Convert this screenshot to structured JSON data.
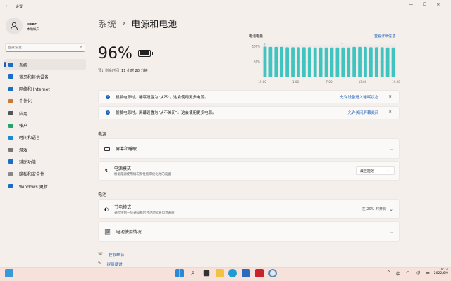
{
  "window": {
    "title": "设置",
    "back": "←"
  },
  "window_controls": {
    "minimize": "—",
    "maximize": "☐",
    "close": "✕"
  },
  "user": {
    "name": "user",
    "type": "本地帐户"
  },
  "search": {
    "placeholder": "查找设置"
  },
  "sidebar": {
    "items": [
      {
        "label": "系统",
        "color": "#1a6fc4"
      },
      {
        "label": "蓝牙和其他设备",
        "color": "#1a6fc4"
      },
      {
        "label": "网络和 Internet",
        "color": "#1a6fc4"
      },
      {
        "label": "个性化",
        "color": "#c77b3a"
      },
      {
        "label": "应用",
        "color": "#555"
      },
      {
        "label": "帐户",
        "color": "#2aa36b"
      },
      {
        "label": "时间和语言",
        "color": "#1a8ad4"
      },
      {
        "label": "游戏",
        "color": "#777"
      },
      {
        "label": "辅助功能",
        "color": "#1a6fc4"
      },
      {
        "label": "隐私和安全性",
        "color": "#888"
      },
      {
        "label": "Windows 更新",
        "color": "#1a6fc4"
      }
    ]
  },
  "breadcrumb": {
    "parent": "系统",
    "sep": "›",
    "current": "电源和电池"
  },
  "battery": {
    "percent": "96%",
    "estimate_label": "预计剩余时间",
    "estimate": "11 小时 28 分钟"
  },
  "chart_data": {
    "type": "bar",
    "title": "电池电量",
    "link": "查看详细信息",
    "ylim": [
      0,
      100
    ],
    "yticks": [
      "100%",
      "50%"
    ],
    "xticks": [
      "19:00",
      "1:00",
      "7:00",
      "13:00",
      "19:00"
    ],
    "values": [
      99,
      98,
      98,
      98,
      97,
      97,
      97,
      97,
      97,
      96,
      96,
      96,
      96,
      96,
      96,
      96,
      98,
      98,
      98,
      97,
      97,
      97,
      96,
      96
    ],
    "color": "#3fc4c0"
  },
  "notices": [
    {
      "text": "拔掉电源时，睡眠设置为\"从不\"。这会使用更多电源。",
      "link": "允许设备进入睡眠状态",
      "close": "✕"
    },
    {
      "text": "拔掉电源时，屏幕设置为\"从不关闭\"。这会使用更多电源。",
      "link": "允许关闭屏幕关闭",
      "close": "✕"
    }
  ],
  "power": {
    "heading": "电源",
    "screen_sleep": "屏幕和睡眠",
    "mode_title": "电源模式",
    "mode_sub": "根据电源使用情况和性能来优化你的设备",
    "mode_value": "最佳能效"
  },
  "battery_section": {
    "heading": "电池",
    "saver_title": "节电模式",
    "saver_sub": "通过限制一些通知和后台活动延长电池寿命",
    "saver_value": "在 20% 时开启",
    "usage": "电池使用情况"
  },
  "links": {
    "help": "获取帮助",
    "feedback": "提供反馈"
  },
  "taskbar": {
    "time": "19:14",
    "date": "2022/6/9",
    "ime": "中",
    "tray_up": "^"
  }
}
